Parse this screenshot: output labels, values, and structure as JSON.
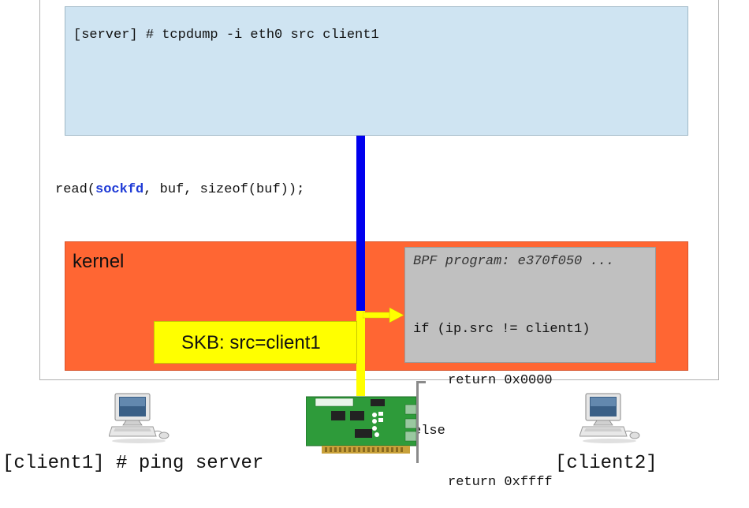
{
  "server": {
    "command": "[server] # tcpdump -i eth0 src client1"
  },
  "syscall": {
    "prefix": "read(",
    "keyword": "sockfd",
    "suffix": ", buf, sizeof(buf));"
  },
  "kernel": {
    "label": "kernel"
  },
  "bpf": {
    "title": "BPF program: e370f050 ...",
    "lines": [
      "if (ip.src != client1)",
      "return 0x0000",
      "else",
      "return 0xffff"
    ]
  },
  "skb": {
    "label": "SKB: src=client1"
  },
  "clients": {
    "client1_command": "[client1] # ping server",
    "client2_label": "[client2]"
  },
  "colors": {
    "user_space": "#cfe4f2",
    "kernel": "#ff6633",
    "bpf_box": "#c0c0c0",
    "skb": "#ffff00",
    "blue_path": "#0000ee",
    "yellow_path": "#ffff00",
    "syscall_keyword": "#1f3bd6",
    "nic_board": "#2e9b3a"
  },
  "icons": {
    "client1": "desktop-computer-icon",
    "client2": "desktop-computer-icon",
    "nic": "network-interface-card-icon"
  }
}
